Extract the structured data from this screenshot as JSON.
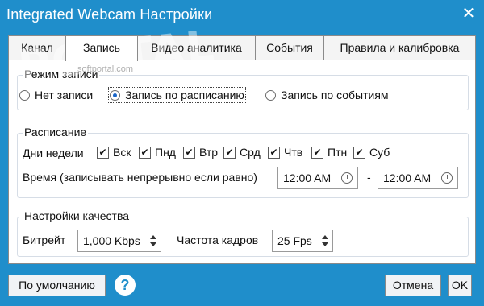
{
  "window": {
    "title": "Integrated Webcam Настройки",
    "close_glyph": "✕"
  },
  "tabs": [
    {
      "label": "Канал"
    },
    {
      "label": "Запись"
    },
    {
      "label": "Видео аналитика"
    },
    {
      "label": "События"
    },
    {
      "label": "Правила и калибровка"
    }
  ],
  "active_tab": "Запись",
  "record_mode": {
    "title": "Режим записи",
    "options": [
      {
        "label": "Нет записи",
        "selected": false
      },
      {
        "label": "Запись по расписанию",
        "selected": true
      },
      {
        "label": "Запись по событиям",
        "selected": false
      }
    ]
  },
  "schedule": {
    "title": "Расписание",
    "weekdays_label": "Дни недели",
    "days": [
      {
        "label": "Вск",
        "checked": true
      },
      {
        "label": "Пнд",
        "checked": true
      },
      {
        "label": "Втр",
        "checked": true
      },
      {
        "label": "Срд",
        "checked": true
      },
      {
        "label": "Чтв",
        "checked": true
      },
      {
        "label": "Птн",
        "checked": true
      },
      {
        "label": "Суб",
        "checked": true
      }
    ],
    "time_label": "Время (записывать непрерывно если равно)",
    "start_time": "12:00 AM",
    "separator": "-",
    "end_time": "12:00 AM"
  },
  "quality": {
    "title": "Настройки качества",
    "bitrate_label": "Битрейт",
    "bitrate_value": "1,000 Kbps",
    "fps_label": "Частота кадров",
    "fps_value": "25 Fps"
  },
  "footer": {
    "default_label": "По умолчанию",
    "help_glyph": "?",
    "cancel_label": "Отмена",
    "ok_label": "OK"
  },
  "watermark": {
    "text": "PORTAL",
    "sub": "softportal.com"
  },
  "colors": {
    "titlebar": "#1f8ecb",
    "radio_on": "#1a66c9"
  },
  "icons": {
    "close": "close-icon",
    "help": "help-icon",
    "clock": "clock-icon",
    "spin": "spin-arrows-icon"
  }
}
